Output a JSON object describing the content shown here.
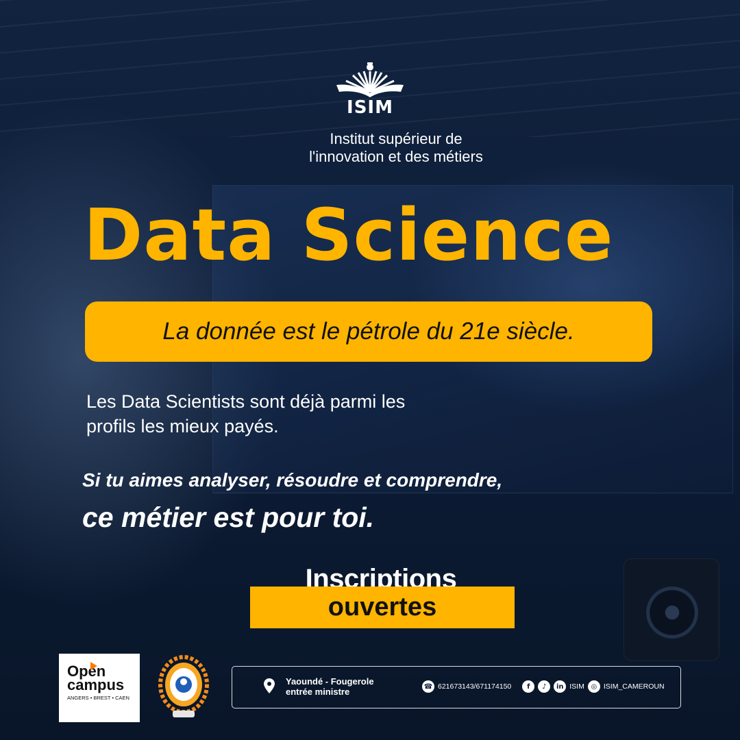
{
  "header": {
    "logo_text": "ISIM",
    "institute_line1": "Institut supérieur de",
    "institute_line2": "l'innovation et des métiers"
  },
  "main": {
    "title": "Data Science",
    "tagline": "La donnée est le pétrole du 21e siècle.",
    "paragraph_line1": "Les Data Scientists sont déjà parmi les",
    "paragraph_line2": "profils les mieux payés.",
    "call_line1": "Si tu aimes analyser, résoudre et comprendre,",
    "call_line2": "ce métier est pour toi."
  },
  "registration": {
    "label_top": "Inscriptions",
    "label_bottom": "ouvertes"
  },
  "footer": {
    "partner_logo_line1": "Open",
    "partner_logo_line2": "campus",
    "partner_logo_cities": "ANGERS • BREST • CAEN",
    "address_line1": "Yaoundé - Fougerole",
    "address_line2": "entrée ministre",
    "phone": "621673143/671174150",
    "social_name": "ISIM",
    "instagram": "ISIM_CAMEROUN"
  },
  "colors": {
    "accent": "#ffb400",
    "background": "#0b1a33"
  },
  "icons": [
    "location-pin-icon",
    "phone-icon",
    "facebook-icon",
    "tiktok-icon",
    "linkedin-icon",
    "instagram-icon"
  ]
}
